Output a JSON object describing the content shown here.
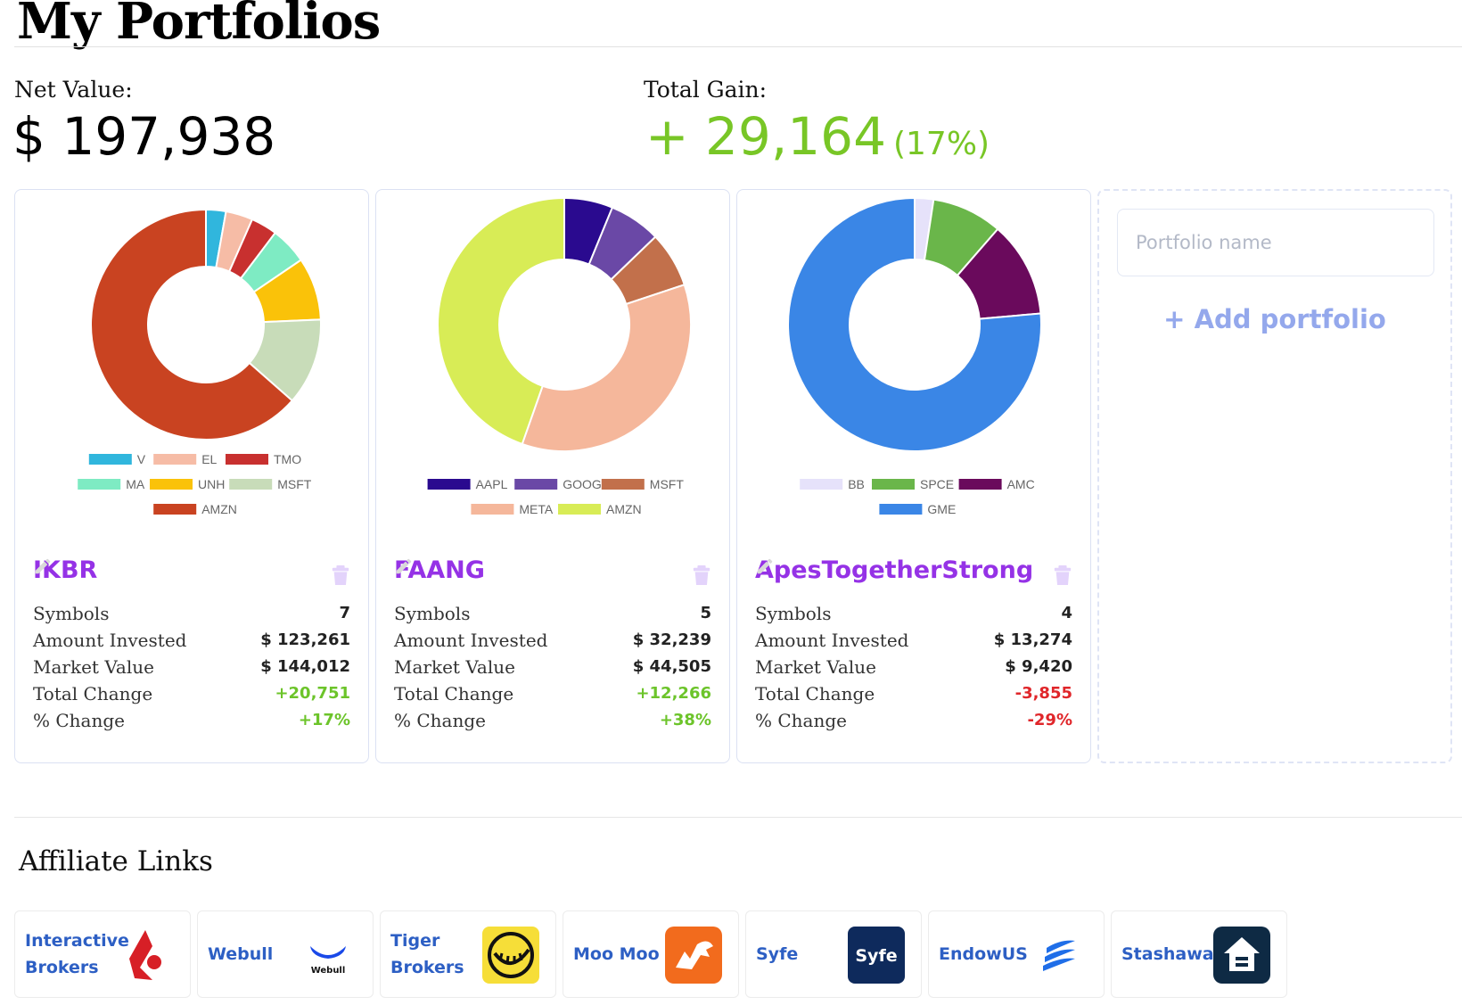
{
  "page_title": "My Portfolios",
  "summary": {
    "net_value_label": "Net Value:",
    "net_value": "$ 197,938",
    "total_gain_label": "Total Gain:",
    "total_gain": "+ 29,164",
    "total_gain_pct": "(17%)"
  },
  "colors": {
    "accent": "#9532e6",
    "positive": "#78c626",
    "negative": "#e0262a",
    "link": "#2d5fc4",
    "add": "#94a8ec"
  },
  "stat_labels": [
    "Symbols",
    "Amount Invested",
    "Market Value",
    "Total Change",
    "% Change"
  ],
  "portfolios": [
    {
      "name": "IKBR",
      "stats": [
        "7",
        "$ 123,261",
        "$ 144,012",
        "+20,751",
        "+17%"
      ],
      "trend": "pos",
      "chart": {
        "legend_rows": [
          [
            "V",
            "EL",
            "TMO"
          ],
          [
            "MA",
            "UNH",
            "MSFT"
          ],
          [
            "AMZN"
          ]
        ],
        "slices": [
          {
            "label": "V",
            "value": 2.8,
            "color": "#30b6dd"
          },
          {
            "label": "EL",
            "value": 3.8,
            "color": "#f6bca6"
          },
          {
            "label": "TMO",
            "value": 3.7,
            "color": "#c8302f"
          },
          {
            "label": "MA",
            "value": 5.2,
            "color": "#7eebc3"
          },
          {
            "label": "UNH",
            "value": 8.8,
            "color": "#fac209"
          },
          {
            "label": "MSFT",
            "value": 12.2,
            "color": "#c8dcb9"
          },
          {
            "label": "AMZN",
            "value": 63.5,
            "color": "#c94321"
          }
        ]
      }
    },
    {
      "name": "FAANG",
      "stats": [
        "5",
        "$ 32,239",
        "$ 44,505",
        "+12,266",
        "+38%"
      ],
      "trend": "pos",
      "chart": {
        "legend_rows": [
          [
            "AAPL",
            "GOOG",
            "MSFT"
          ],
          [
            "META",
            "AMZN"
          ]
        ],
        "slices": [
          {
            "label": "AAPL",
            "value": 6.2,
            "color": "#2a0a8f"
          },
          {
            "label": "GOOG",
            "value": 6.6,
            "color": "#6a48a6"
          },
          {
            "label": "MSFT",
            "value": 7.1,
            "color": "#c2704b"
          },
          {
            "label": "META",
            "value": 35.5,
            "color": "#f5b79b"
          },
          {
            "label": "AMZN",
            "value": 44.6,
            "color": "#d8ec56"
          }
        ]
      }
    },
    {
      "name": "ApesTogetherStrong",
      "stats": [
        "4",
        "$ 13,274",
        "$ 9,420",
        "-3,855",
        "-29%"
      ],
      "trend": "neg",
      "chart": {
        "legend_rows": [
          [
            "BB",
            "SPCE",
            "AMC"
          ],
          [
            "GME"
          ]
        ],
        "slices": [
          {
            "label": "BB",
            "value": 2.4,
            "color": "#e6e2fa"
          },
          {
            "label": "SPCE",
            "value": 9.0,
            "color": "#6ab64a"
          },
          {
            "label": "AMC",
            "value": 12.2,
            "color": "#6a0a5c"
          },
          {
            "label": "GME",
            "value": 76.4,
            "color": "#3a86e6"
          }
        ]
      }
    }
  ],
  "add_portfolio": {
    "placeholder": "Portfolio name",
    "button_label": "+ Add portfolio"
  },
  "affiliate": {
    "title": "Affiliate Links",
    "links": [
      {
        "name": "Interactive Brokers",
        "logo": "interactive-brokers-logo"
      },
      {
        "name": "Webull",
        "logo": "webull-logo",
        "logo_text": "Webull"
      },
      {
        "name": "Tiger Brokers",
        "logo": "tiger-brokers-logo"
      },
      {
        "name": "Moo Moo",
        "logo": "moomoo-logo"
      },
      {
        "name": "Syfe",
        "logo": "syfe-logo",
        "logo_text": "Syfe"
      },
      {
        "name": "EndowUS",
        "logo": "endowus-logo"
      },
      {
        "name": "Stashaway",
        "logo": "stashaway-logo"
      }
    ]
  }
}
